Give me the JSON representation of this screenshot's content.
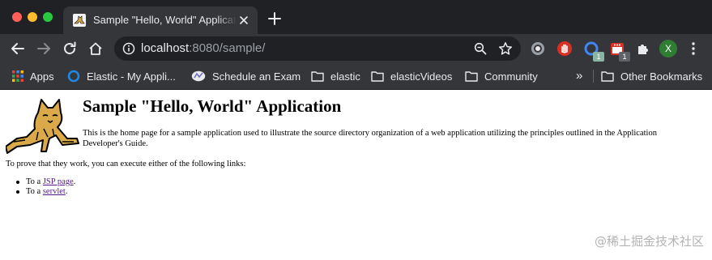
{
  "window": {
    "tab": {
      "title": "Sample \"Hello, World\" Application",
      "favicon": "tomcat-favicon-icon"
    }
  },
  "toolbar": {
    "url_host": "localhost",
    "url_rest": ":8080/sample/",
    "extensions": [
      {
        "name": "record-extension-icon",
        "badge": ""
      },
      {
        "name": "stop-hand-extension-icon",
        "badge": ""
      },
      {
        "name": "camera-extension-icon",
        "badge": "1"
      },
      {
        "name": "calendar-extension-icon",
        "badge": "1"
      },
      {
        "name": "puzzle-extensions-icon",
        "badge": ""
      }
    ],
    "profile_initial": "X"
  },
  "bookmarks": {
    "items": [
      {
        "label": "Apps",
        "icon": "apps-grid-icon"
      },
      {
        "label": "Elastic - My Appli...",
        "icon": "elastic-icon"
      },
      {
        "label": "Schedule an Exam",
        "icon": "exam-icon"
      },
      {
        "label": "elastic",
        "icon": "folder-icon"
      },
      {
        "label": "elasticVideos",
        "icon": "folder-icon"
      },
      {
        "label": "Community",
        "icon": "folder-icon"
      }
    ],
    "overflow": "»",
    "other": "Other Bookmarks"
  },
  "page": {
    "title": "Sample \"Hello, World\" Application",
    "intro": "This is the home page for a sample application used to illustrate the source directory organization of a web application utilizing the principles outlined in the Application Developer's Guide.",
    "prove": "To prove that they work, you can execute either of the following links:",
    "links": [
      {
        "prefix": "To a ",
        "link": "JSP page",
        "suffix": "."
      },
      {
        "prefix": "To a ",
        "link": "servlet",
        "suffix": "."
      }
    ],
    "watermark": "@稀土掘金技术社区"
  },
  "colors": {
    "tabstrip_bg": "#202124",
    "toolbar_bg": "#35363a",
    "visited_link": "#551a8b",
    "profile": "#2e7d32"
  }
}
